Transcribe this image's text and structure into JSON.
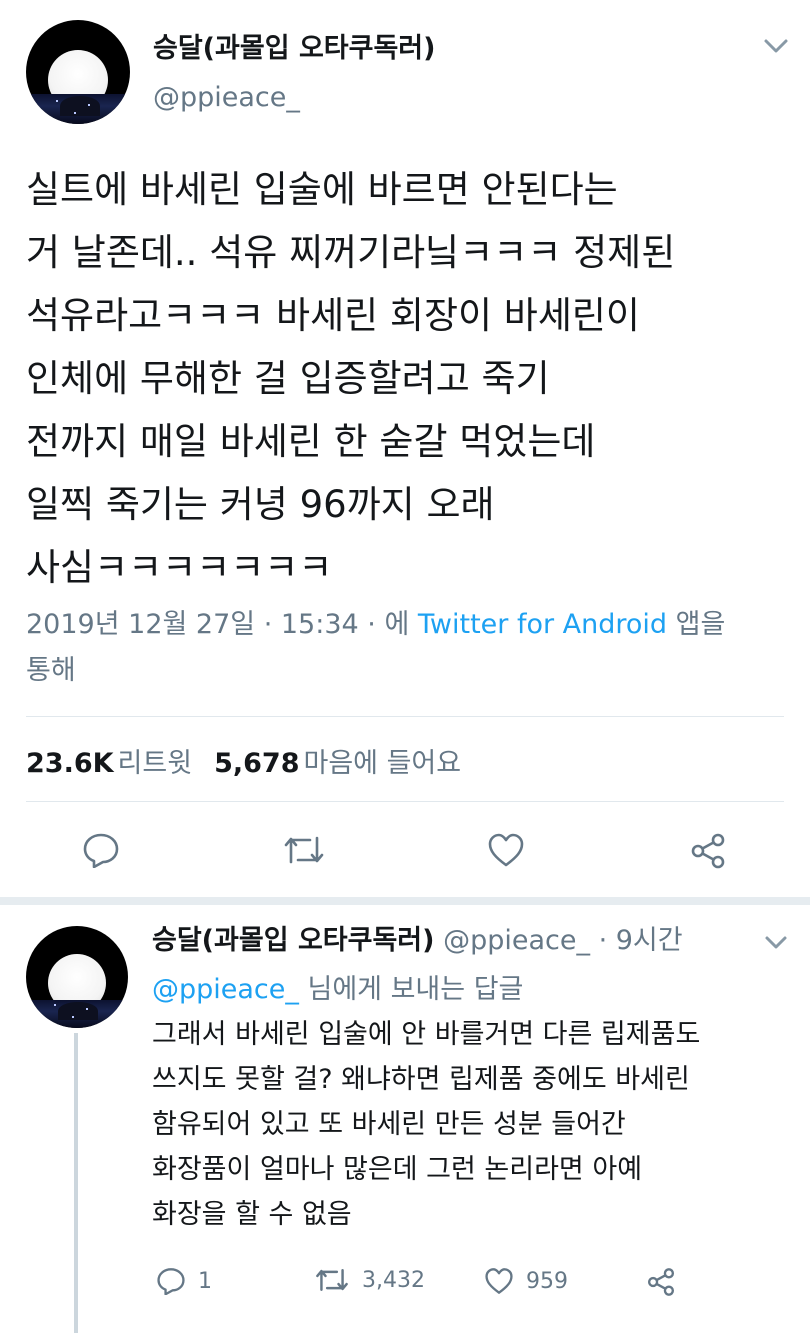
{
  "tweet": {
    "display_name": "승달(과몰입 오타쿠독러)",
    "handle": "@ppieace_",
    "text_lines": [
      "실트에 바세린 입술에 바르면 안된다는",
      "거 날존데.. 석유 찌꺼기라닠ㅋㅋㅋ 정제된",
      "석유라고ㅋㅋㅋ 바세린 회장이 바세린이",
      "인체에 무해한 걸 입증할려고 죽기",
      "전까지 매일 바세린 한 숟갈 먹었는데",
      "일찍 죽기는 커녕 96까지 오래",
      "사심ㅋㅋㅋㅋㅋㅋㅋ"
    ],
    "date": "2019년 12월 27일",
    "sep1": " · ",
    "time": "15:34",
    "sep2": " · ",
    "via_prefix": "에 ",
    "source": "Twitter for Android",
    "via_suffix": " 앱을",
    "via_line2": "통해",
    "retweet_count": "23.6K",
    "retweet_label": "리트윗",
    "like_count": "5,678",
    "like_label": "마음에 들어요",
    "icons": [
      "reply-icon",
      "retweet-icon",
      "heart-icon",
      "share-icon",
      "chevron-down-icon"
    ]
  },
  "reply": {
    "display_name": "승달(과몰입 오타쿠독러)",
    "handle": "@ppieace_",
    "dot": " · ",
    "time": "9시간",
    "reply_to_mention": "@ppieace_",
    "reply_to_suffix": " 님에게 보내는 답글",
    "text_lines": [
      "그래서 바세린 입술에 안 바를거면 다른 립제품도",
      "쓰지도 못할 걸? 왜냐하면 립제품 중에도 바세린",
      "함유되어 있고 또 바세린 만든 성분 들어간",
      "화장품이 얼마나 많은데 그런 논리라면 아예",
      "화장을 할 수 없음"
    ],
    "reply_count": "1",
    "retweet_count": "3,432",
    "like_count": "959"
  },
  "colors": {
    "text": "#14171a",
    "secondary": "#657786",
    "link": "#1da1f2",
    "divider": "#e1e8ed",
    "separator": "#e6ecf0",
    "thread_line": "#ccd6dd"
  }
}
